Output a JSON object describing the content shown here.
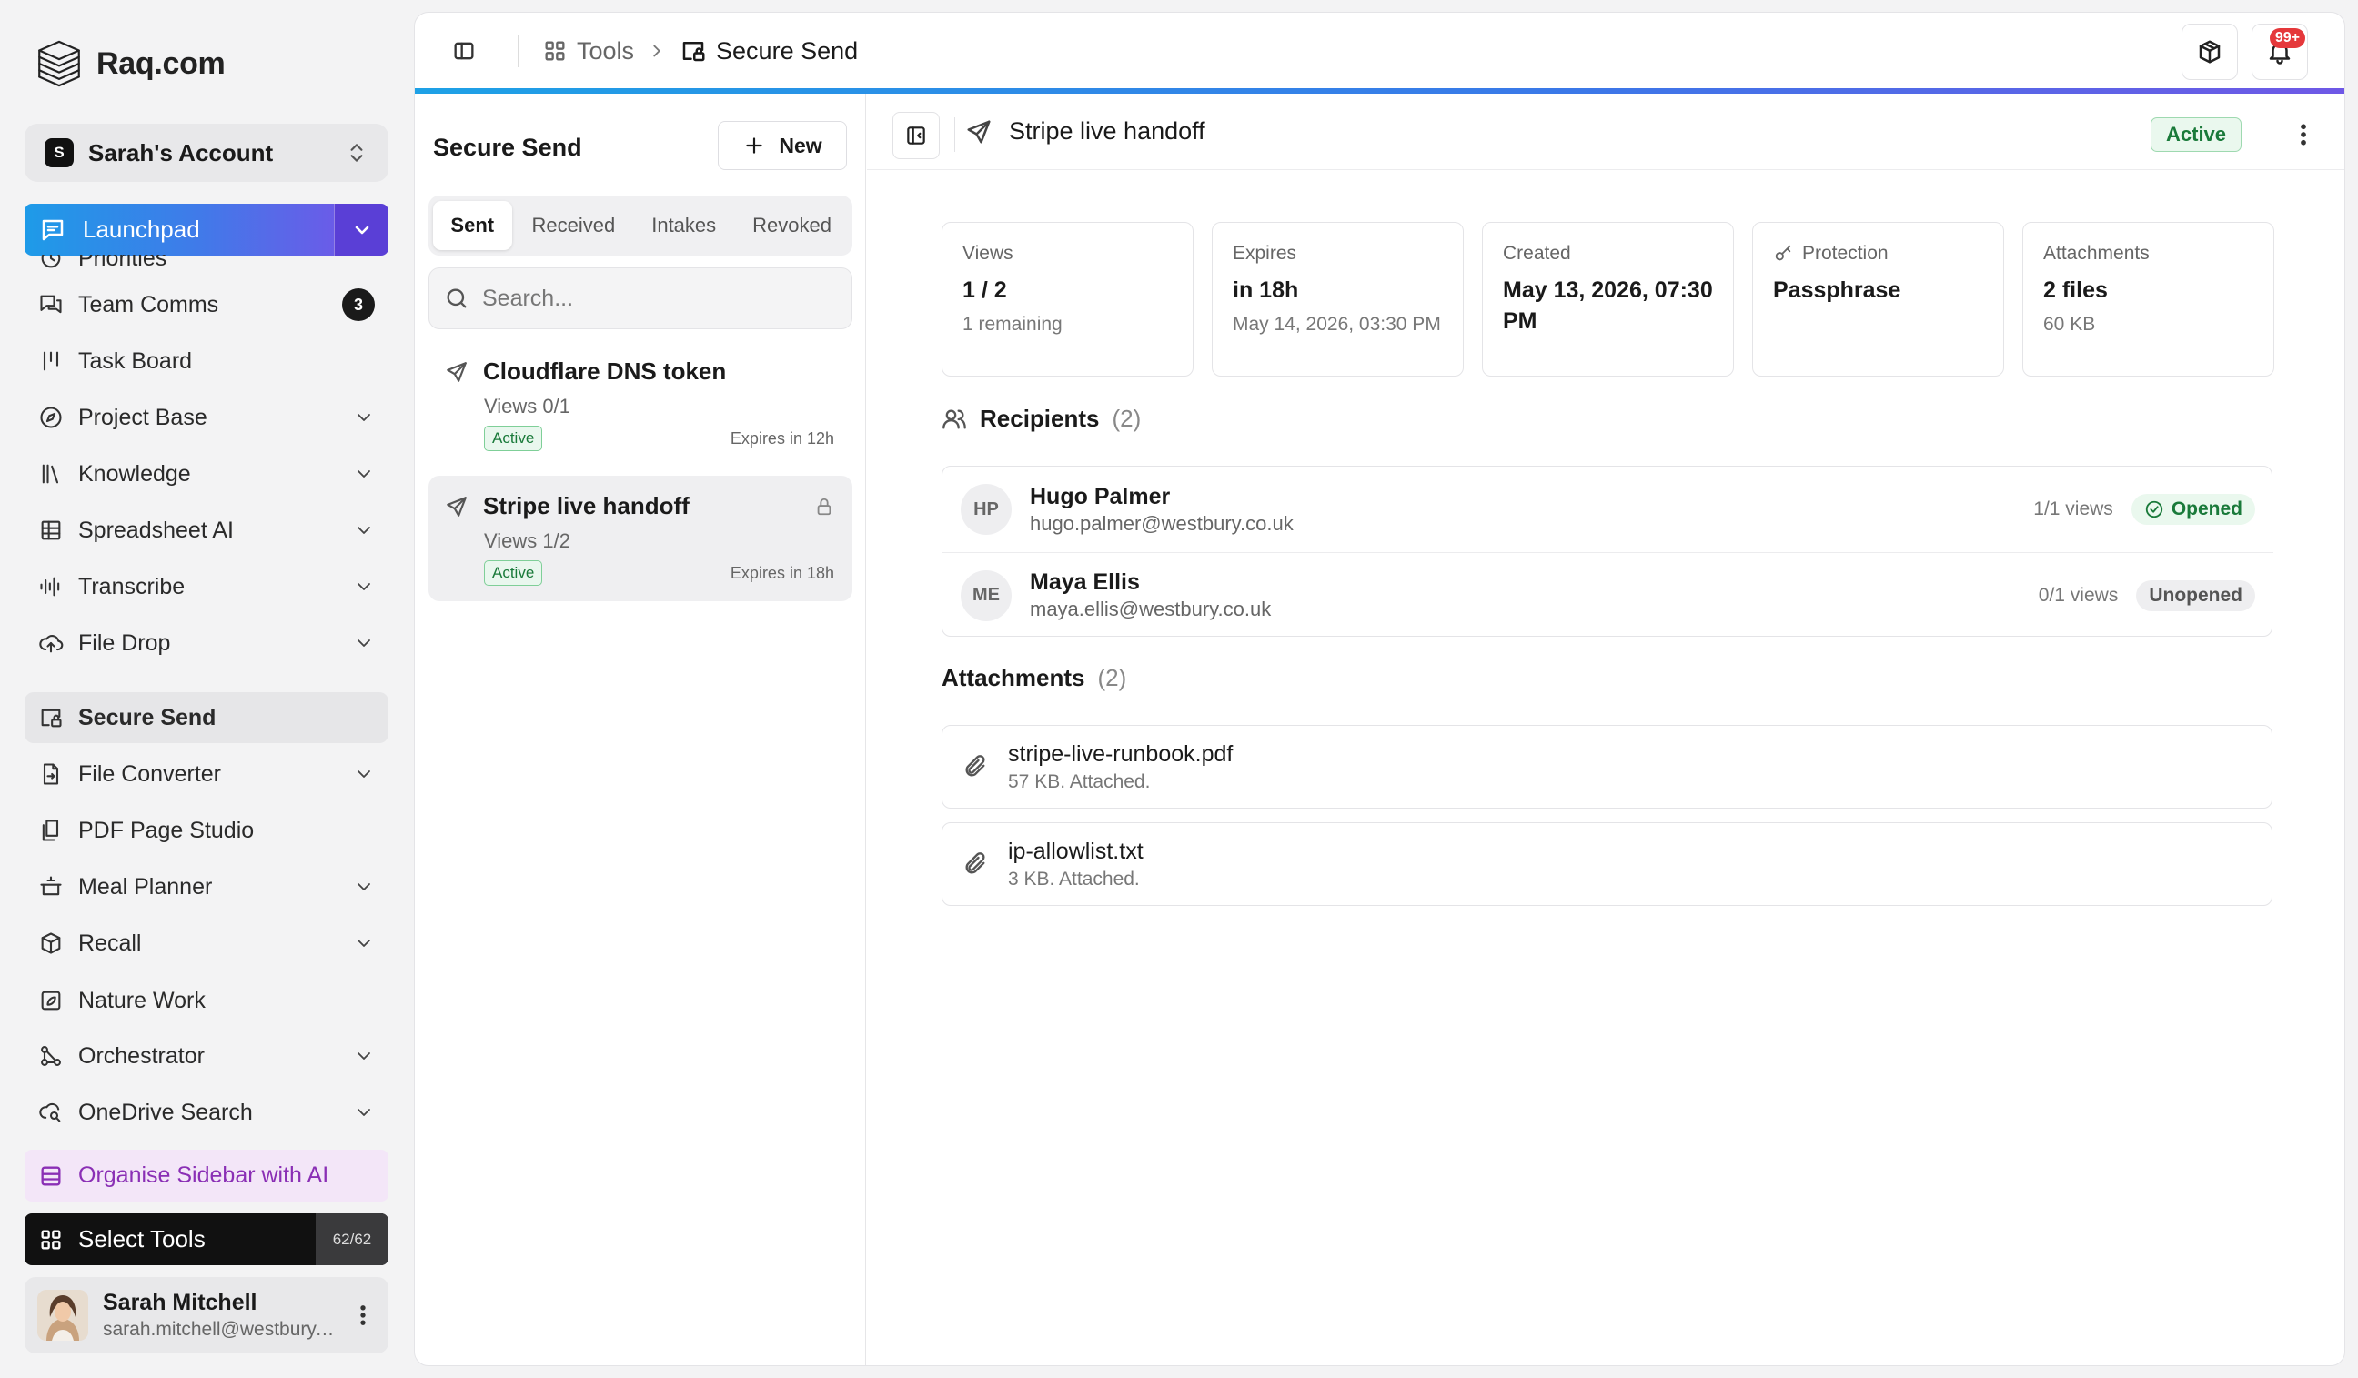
{
  "brand": {
    "name": "Raq.com"
  },
  "account": {
    "initial": "S",
    "label": "Sarah's Account"
  },
  "launchpad": {
    "label": "Launchpad"
  },
  "nav": [
    {
      "label": "Priorities",
      "icon": "priorities-icon"
    },
    {
      "label": "Team Comms",
      "icon": "chat-icon",
      "count": "3"
    },
    {
      "label": "Task Board",
      "icon": "kanban-icon"
    },
    {
      "label": "Project Base",
      "icon": "compass-icon",
      "chevron": true
    },
    {
      "label": "Knowledge",
      "icon": "library-icon",
      "chevron": true
    },
    {
      "label": "Spreadsheet AI",
      "icon": "table-icon",
      "chevron": true
    },
    {
      "label": "Transcribe",
      "icon": "audio-wave-icon",
      "chevron": true
    },
    {
      "label": "File Drop",
      "icon": "cloud-upload-icon",
      "chevron": true
    },
    {
      "label": "Secure Send",
      "icon": "secure-send-icon",
      "active": true
    },
    {
      "label": "File Converter",
      "icon": "file-convert-icon",
      "chevron": true
    },
    {
      "label": "PDF Page Studio",
      "icon": "pdf-pages-icon"
    },
    {
      "label": "Meal Planner",
      "icon": "cooking-pot-icon",
      "chevron": true
    },
    {
      "label": "Recall",
      "icon": "cube-icon",
      "chevron": true
    },
    {
      "label": "Nature Work",
      "icon": "leaf-image-icon"
    },
    {
      "label": "Orchestrator",
      "icon": "workflow-icon",
      "chevron": true
    },
    {
      "label": "OneDrive Search",
      "icon": "cloud-search-icon",
      "chevron": true
    }
  ],
  "organise": {
    "label": "Organise Sidebar with AI"
  },
  "select_tools": {
    "label": "Select Tools",
    "count": "62/62"
  },
  "user": {
    "name": "Sarah Mitchell",
    "email": "sarah.mitchell@westbury.co.uk"
  },
  "topbar": {
    "breadcrumb_root": "Tools",
    "breadcrumb_current": "Secure Send",
    "notification_count": "99+"
  },
  "list": {
    "title": "Secure Send",
    "new_label": "New",
    "tabs": [
      "Sent",
      "Received",
      "Intakes",
      "Revoked"
    ],
    "search_placeholder": "Search...",
    "items": [
      {
        "title": "Cloudflare DNS token",
        "views": "Views 0/1",
        "status": "Active",
        "expires": "Expires in 12h",
        "locked": false
      },
      {
        "title": "Stripe live handoff",
        "views": "Views 1/2",
        "status": "Active",
        "expires": "Expires in 18h",
        "locked": true
      }
    ]
  },
  "detail": {
    "title": "Stripe live handoff",
    "status": "Active",
    "stats": [
      {
        "label": "Views",
        "value": "1 / 2",
        "sub": "1 remaining"
      },
      {
        "label": "Expires",
        "value": "in 18h",
        "sub": "May 14, 2026, 03:30 PM"
      },
      {
        "label": "Created",
        "value": "May 13, 2026, 07:30 PM",
        "sub": ""
      },
      {
        "label": "Protection",
        "value": "Passphrase",
        "sub": "",
        "icon": "key-icon"
      },
      {
        "label": "Attachments",
        "value": "2 files",
        "sub": "60 KB"
      }
    ],
    "recipients_title": "Recipients",
    "recipients_count": "(2)",
    "recipients": [
      {
        "initials": "HP",
        "name": "Hugo Palmer",
        "email": "hugo.palmer@westbury.co.uk",
        "views": "1/1 views",
        "status": "Opened"
      },
      {
        "initials": "ME",
        "name": "Maya Ellis",
        "email": "maya.ellis@westbury.co.uk",
        "views": "0/1 views",
        "status": "Unopened"
      }
    ],
    "attachments_title": "Attachments",
    "attachments_count": "(2)",
    "attachments": [
      {
        "name": "stripe-live-runbook.pdf",
        "meta": "57 KB. Attached."
      },
      {
        "name": "ip-allowlist.txt",
        "meta": "3 KB. Attached."
      }
    ]
  }
}
